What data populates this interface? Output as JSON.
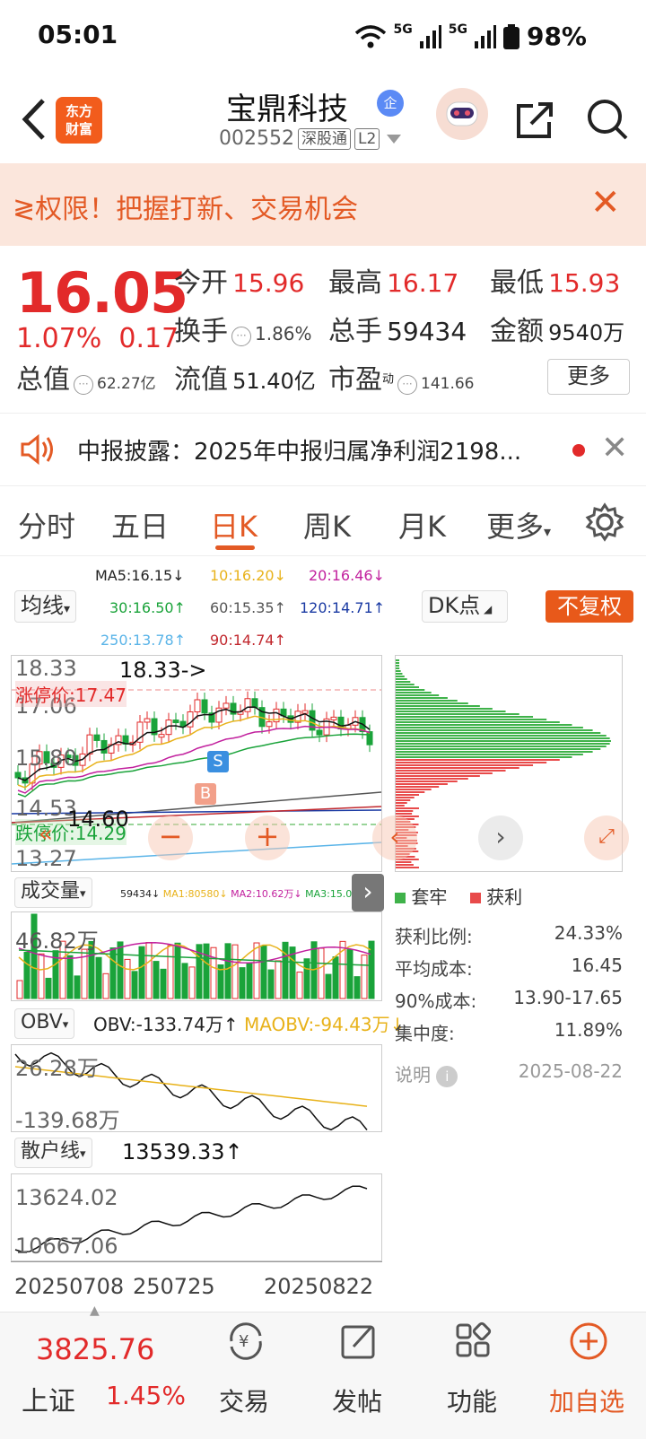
{
  "status": {
    "time": "05:01",
    "signal1": "5G",
    "signal2": "5G",
    "battery": "98%"
  },
  "header": {
    "logo_line1": "东方",
    "logo_line2": "财富",
    "name": "宝鼎科技",
    "badge": "企",
    "code": "002552",
    "tag1": "深股通",
    "tag2": "L2"
  },
  "banner": {
    "text": "≷权限！把握打新、交易机会"
  },
  "quote": {
    "price": "16.05",
    "pct": "1.07%",
    "chg": "0.17",
    "open_label": "今开",
    "open": "15.96",
    "high_label": "最高",
    "high": "16.17",
    "low_label": "最低",
    "low": "15.93",
    "turnover_label": "换手",
    "turnover": "1.86%",
    "vol_label": "总手",
    "vol": "59434",
    "amount_label": "金额",
    "amount": "9540万",
    "mcap_label": "总值",
    "mcap": "62.27亿",
    "float_label": "流值",
    "float": "51.40亿",
    "pe_label": "市盈",
    "pe_sup": "动",
    "pe": "141.66",
    "more": "更多"
  },
  "notice": {
    "text": "中报披露：2025年中报归属净利润2198..."
  },
  "tabs": {
    "t1": "分时",
    "t2": "五日",
    "t3": "日K",
    "t4": "周K",
    "t5": "月K",
    "t6": "更多"
  },
  "ma": {
    "selector": "均线",
    "ma5": "MA5:16.15↓",
    "ma10": "10:16.20↓",
    "ma20": "20:16.46↓",
    "ma30": "30:16.50↑",
    "ma60": "60:15.35↑",
    "ma120": "120:14.71↑",
    "ma250": "250:13.78↑",
    "ma90": "90:14.74↑",
    "dk": "DK点",
    "fuquan": "不复权"
  },
  "kline": {
    "y1": "18.33",
    "y2": "17.06",
    "y3": "15.80",
    "y4": "14.53",
    "y5": "13.27",
    "peak": "18.33->",
    "limit_up": "涨停价:17.47",
    "limit_down": "跌停价:14.29",
    "low_mark": "14.60",
    "s": "S",
    "b": "B"
  },
  "volume": {
    "selector": "成交量",
    "line": "59434↓",
    "ma1": "MA1:80580↓",
    "ma2": "MA2:10.62万↓",
    "ma3": "MA3:15.02万↓",
    "max": "46.82万"
  },
  "obv": {
    "selector": "OBV",
    "obv": "OBV:-133.74万↑",
    "maobv": "MAOBV:-94.43万↓",
    "top": "26.28万",
    "bottom": "-139.68万"
  },
  "retail": {
    "selector": "散户线",
    "value": "13539.33↑",
    "top": "13624.02",
    "bottom": "10667.06"
  },
  "xaxis": {
    "d1": "20250708",
    "d2": "250725",
    "d3": "20250822"
  },
  "chips": {
    "legend_trap": "套牢",
    "legend_profit": "获利",
    "profit_ratio_label": "获利比例:",
    "profit_ratio": "24.33%",
    "avg_cost_label": "平均成本:",
    "avg_cost": "16.45",
    "cost90_label": "90%成本:",
    "cost90": "13.90-17.65",
    "conc_label": "集中度:",
    "conc": "11.89%",
    "note": "说明",
    "date": "2025-08-22"
  },
  "nav": {
    "index_value": "3825.76",
    "index_name": "上证",
    "index_pct": "1.45%",
    "trade": "交易",
    "post": "发帖",
    "func": "功能",
    "watch": "加自选"
  },
  "colors": {
    "red": "#e22a2a",
    "green": "#1aa33a",
    "orange": "#e8591a"
  }
}
